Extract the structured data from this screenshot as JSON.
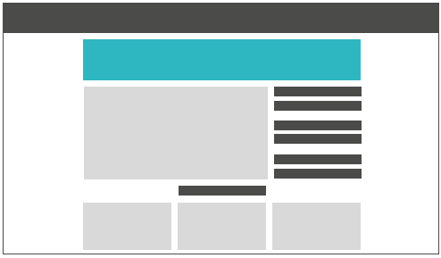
{
  "colors": {
    "frame_border": "#4b4b4a",
    "topbar": "#4b4b4a",
    "hero": "#2fb7c1",
    "placeholder": "#d9d9d9",
    "text_line": "#4b4b4a",
    "background": "#ffffff"
  },
  "sidebar_lines": 6,
  "cards": 3
}
